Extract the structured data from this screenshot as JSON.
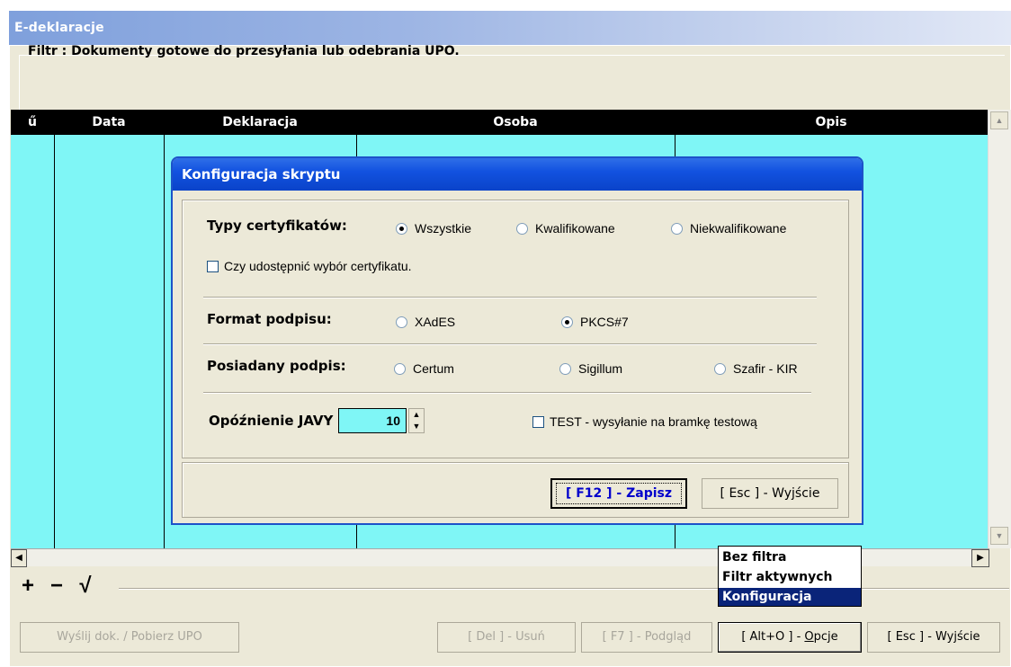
{
  "window": {
    "title": "E-deklaracje"
  },
  "filter": {
    "label": "Filtr : Dokumenty gotowe do przesyłania lub odebrania UPO."
  },
  "grid": {
    "columns": [
      "ű",
      "Data",
      "Deklaracja",
      "Osoba",
      "Opis"
    ],
    "scroll_left": "◀",
    "scroll_right": "▶",
    "scroll_up": "▲",
    "scroll_down": "▼"
  },
  "toolbar": {
    "add": "+",
    "remove": "−",
    "confirm": "√"
  },
  "buttons": {
    "send": "Wyślij dok. / Pobierz UPO",
    "delete": "[ Del ] - Usuń",
    "preview": "[ F7 ] - Podgląd",
    "options_prefix": "[ Alt+O ] - ",
    "options_key": "O",
    "options_rest": "pcje",
    "exit": "[ Esc ] - Wyjście"
  },
  "popup_menu": {
    "items": [
      "Bez filtra",
      "Filtr aktywnych",
      "Konfiguracja"
    ],
    "selected": "Konfiguracja"
  },
  "dialog": {
    "title": "Konfiguracja skryptu",
    "cert_types": {
      "label": "Typy certyfikatów:",
      "options": [
        "Wszystkie",
        "Kwalifikowane",
        "Niekwalifikowane"
      ],
      "selected": "Wszystkie"
    },
    "share_cert_choice": {
      "label": "Czy udostępnić wybór certyfikatu.",
      "checked": false
    },
    "signature_format": {
      "label": "Format podpisu:",
      "options": [
        "XAdES",
        "PKCS#7"
      ],
      "selected": "PKCS#7"
    },
    "owned_signature": {
      "label": "Posiadany podpis:",
      "options": [
        "Certum",
        "Sigillum",
        "Szafir - KIR"
      ],
      "selected": ""
    },
    "java_delay": {
      "label": "Opóźnienie JAVY",
      "value": "10"
    },
    "test_mode": {
      "label": "TEST - wysyłanie na bramkę testową",
      "checked": false
    },
    "save_button": "[ F12 ] - Zapisz",
    "exit_button": "[ Esc ] - Wyjście"
  },
  "colors": {
    "grid_bg": "#7ff6f6",
    "dialog_title": "#0a43c9",
    "menu_selected": "#0a2479"
  }
}
